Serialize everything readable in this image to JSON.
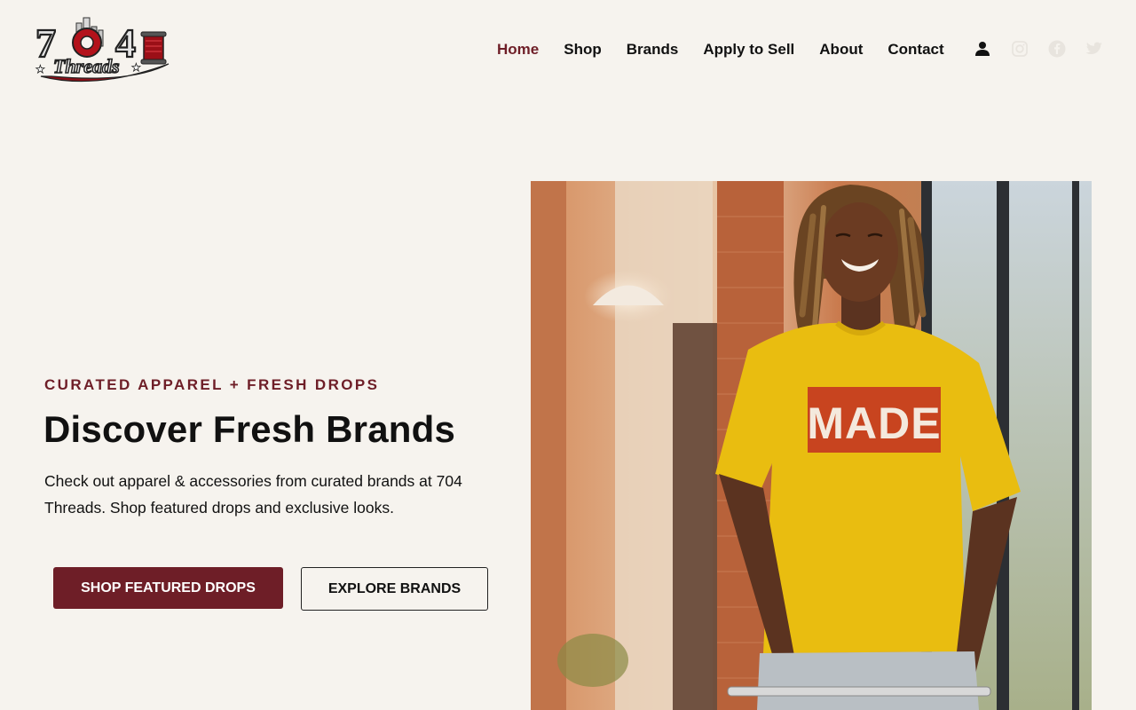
{
  "brand": {
    "logo_text_top": "704",
    "logo_text_script": "Threads"
  },
  "nav": {
    "items": [
      {
        "label": "Home",
        "active": true
      },
      {
        "label": "Shop",
        "active": false
      },
      {
        "label": "Brands",
        "active": false
      },
      {
        "label": "Apply to Sell",
        "active": false
      },
      {
        "label": "About",
        "active": false
      },
      {
        "label": "Contact",
        "active": false
      }
    ],
    "icons": [
      "user-icon",
      "instagram-icon",
      "facebook-icon",
      "twitter-icon"
    ]
  },
  "hero": {
    "eyebrow": "CURATED APPAREL + FRESH DROPS",
    "headline": "Discover Fresh Brands",
    "description": "Check out apparel & accessories from curated brands at 704 Threads. Shop featured drops and exclusive looks.",
    "primary_cta": "SHOP FEATURED DROPS",
    "secondary_cta": "EXPLORE BRANDS",
    "image_shirt_text": "MADE"
  },
  "colors": {
    "background": "#f6f3ee",
    "accent": "#6e1e27",
    "text": "#111111",
    "shirt": "#e9bd10",
    "shirt_print": "#c8441f"
  }
}
